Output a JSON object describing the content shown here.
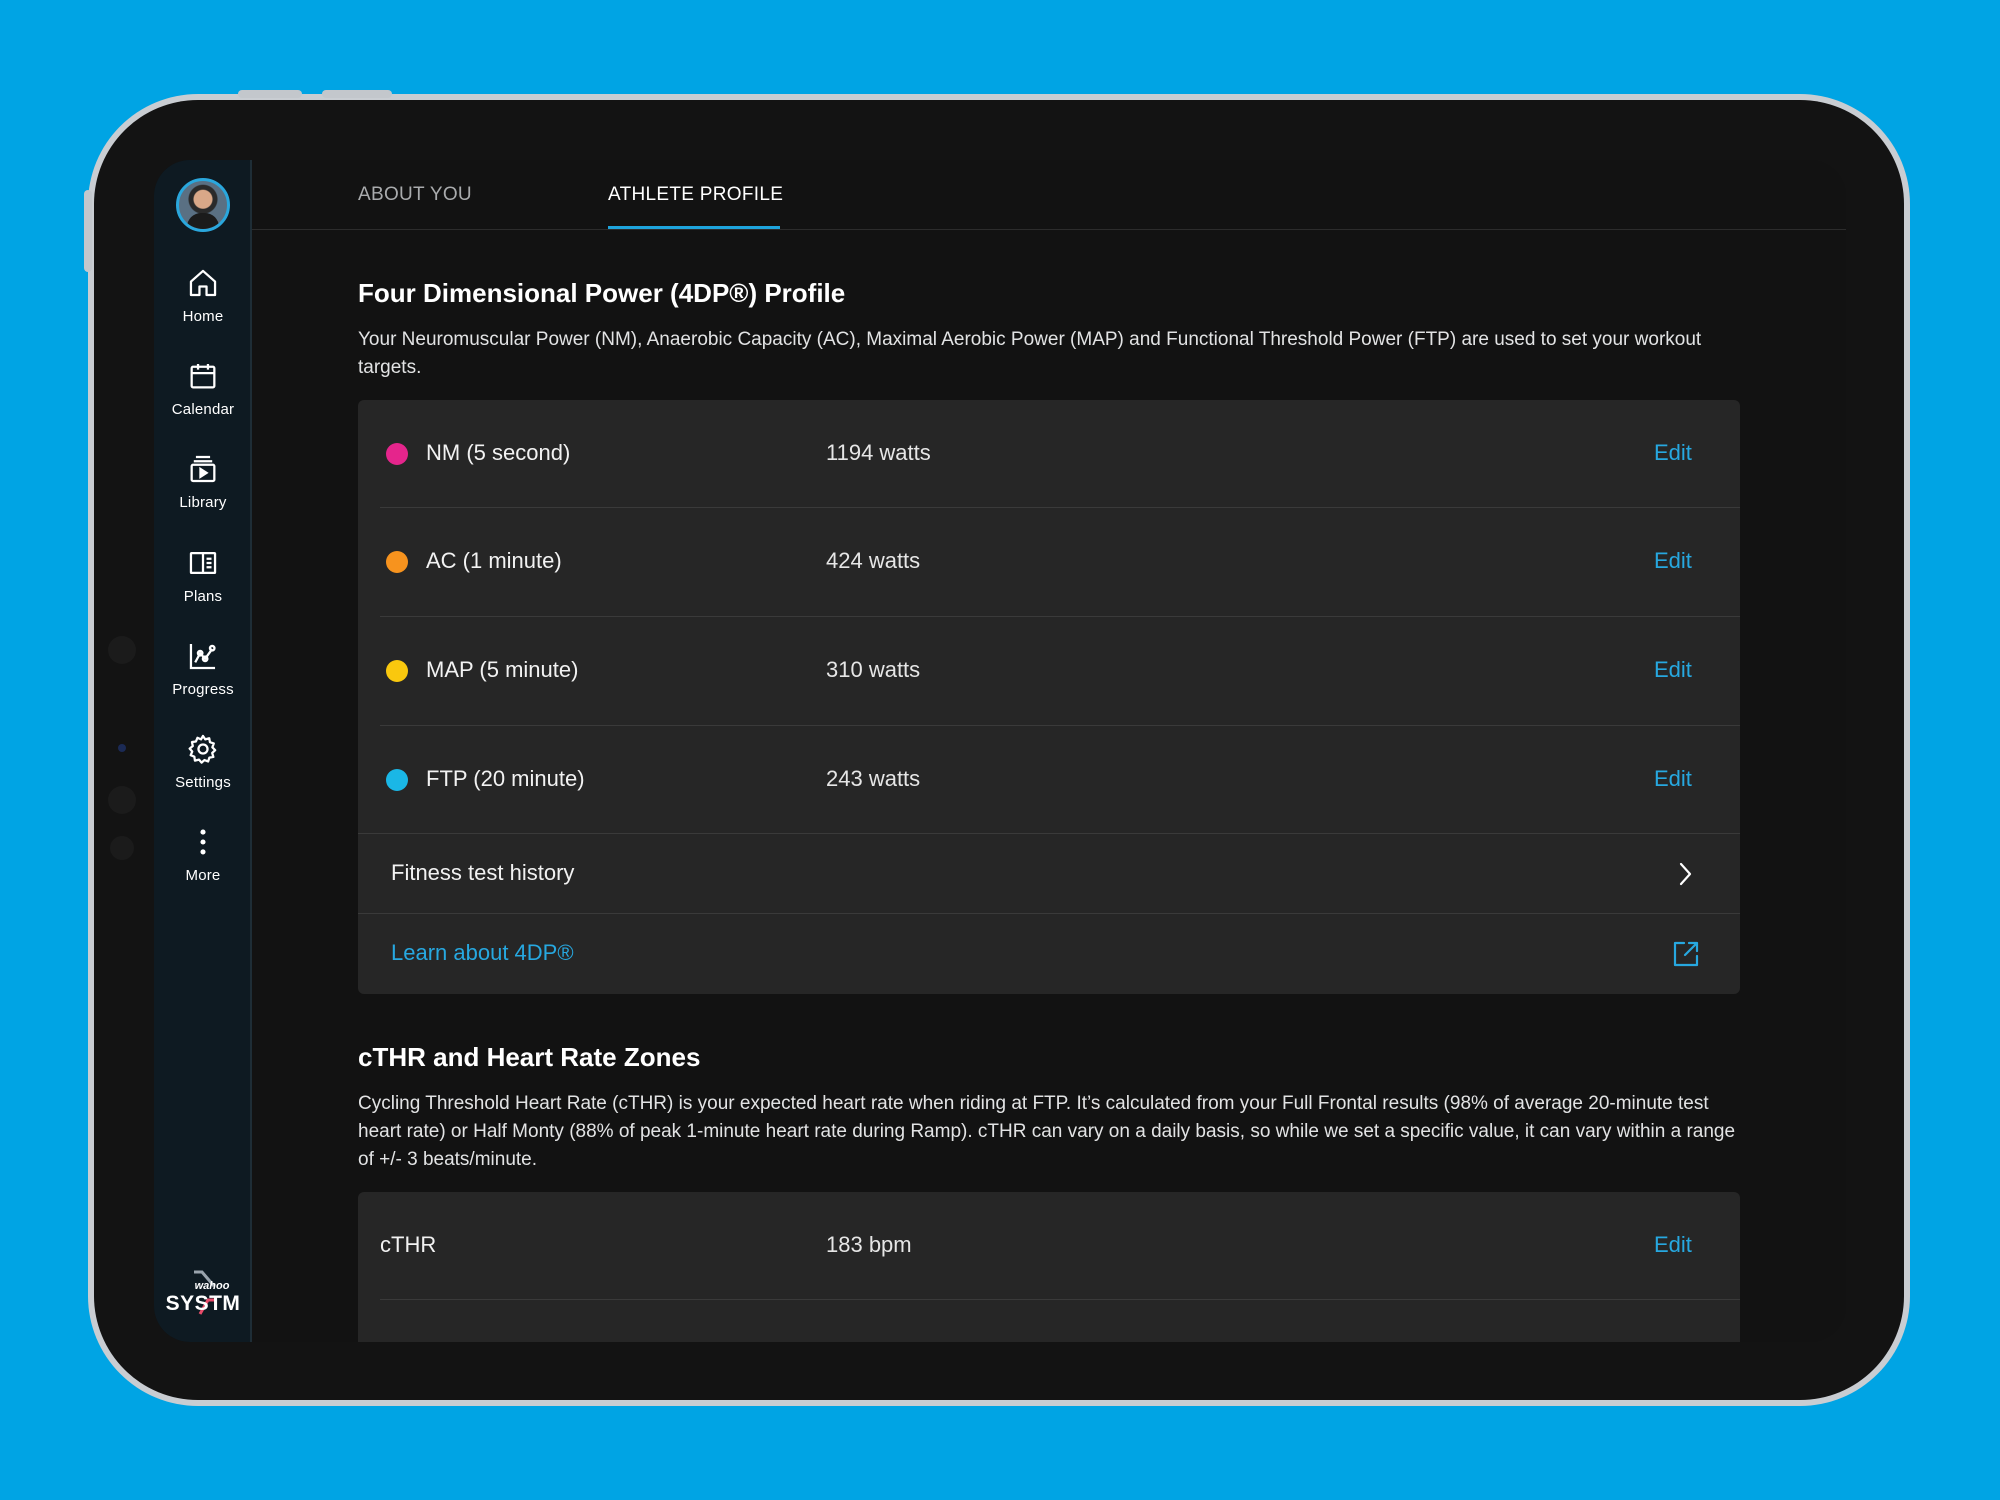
{
  "colors": {
    "background": "#00a4e4",
    "accent": "#27a8e0",
    "nm": "#e5258c",
    "ac": "#f7931e",
    "map": "#f9c80e",
    "ftp": "#1ab7e6"
  },
  "sidebar": {
    "items": [
      {
        "label": "Home",
        "icon": "home-icon"
      },
      {
        "label": "Calendar",
        "icon": "calendar-icon"
      },
      {
        "label": "Library",
        "icon": "library-icon"
      },
      {
        "label": "Plans",
        "icon": "plans-icon"
      },
      {
        "label": "Progress",
        "icon": "progress-icon"
      },
      {
        "label": "Settings",
        "icon": "gear-icon"
      },
      {
        "label": "More",
        "icon": "more-icon"
      }
    ],
    "brand_small": "wahoo",
    "brand_big": "SYSTM"
  },
  "tabs": [
    {
      "label": "ABOUT YOU",
      "active": false
    },
    {
      "label": "ATHLETE PROFILE",
      "active": true
    }
  ],
  "power_profile": {
    "title": "Four Dimensional Power (4DP®) Profile",
    "description": "Your Neuromuscular Power (NM), Anaerobic Capacity (AC), Maximal Aerobic Power (MAP) and Functional Threshold Power (FTP) are used to set your workout targets.",
    "rows": [
      {
        "label": "NM (5 second)",
        "value": "1194 watts",
        "action": "Edit",
        "color": "#e5258c"
      },
      {
        "label": "AC (1 minute)",
        "value": "424 watts",
        "action": "Edit",
        "color": "#f7931e"
      },
      {
        "label": "MAP (5 minute)",
        "value": "310 watts",
        "action": "Edit",
        "color": "#f9c80e"
      },
      {
        "label": "FTP (20 minute)",
        "value": "243 watts",
        "action": "Edit",
        "color": "#1ab7e6"
      }
    ],
    "history_label": "Fitness test history",
    "learn_label": "Learn about 4DP®"
  },
  "heart_rate": {
    "title": "cTHR and Heart Rate Zones",
    "description": "Cycling Threshold Heart Rate (cTHR) is your expected heart rate when riding at FTP. It’s calculated from your Full Frontal results (98% of average 20-minute test heart rate) or Half Monty (88% of peak 1-minute heart rate during Ramp). cTHR can vary on a daily basis, so while we set a specific value, it can vary within a range of +/- 3 beats/minute.",
    "rows": [
      {
        "label": "cTHR",
        "value": "183 bpm",
        "action": "Edit"
      }
    ]
  }
}
